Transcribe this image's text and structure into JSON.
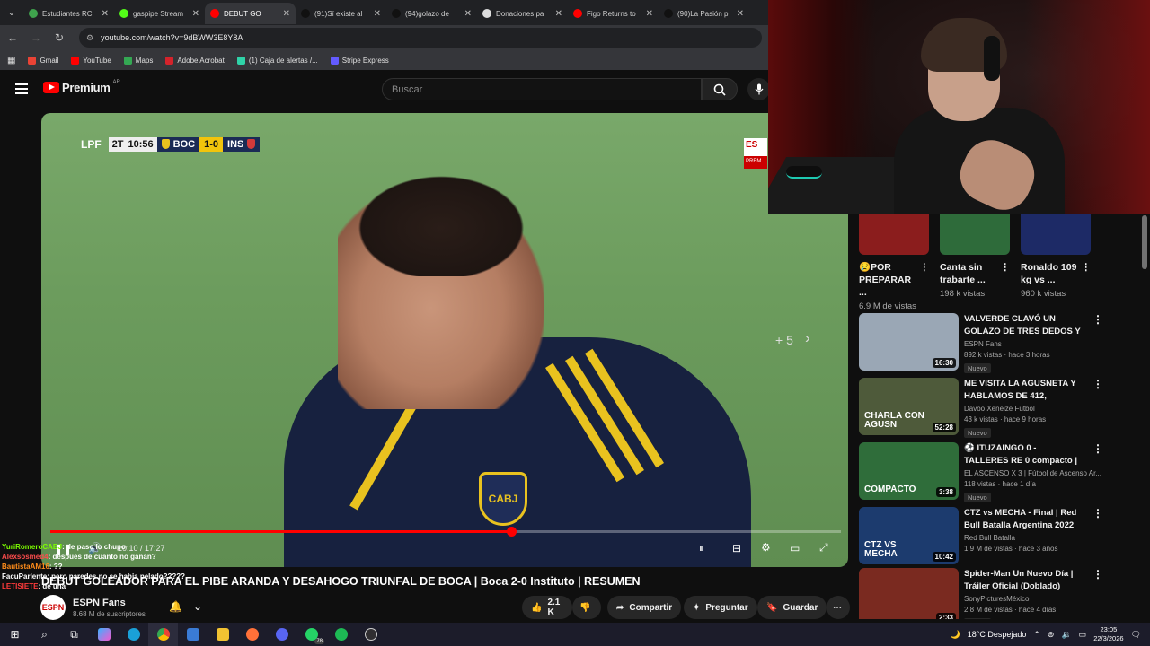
{
  "browser": {
    "tabs": [
      {
        "label": "Estudiantes RC",
        "color": "#3fa34d",
        "active": false
      },
      {
        "label": "gaspipe Stream",
        "color": "#53fc18",
        "active": false
      },
      {
        "label": "DEBUT GO",
        "color": "#ff0000",
        "active": true
      },
      {
        "label": "(91)Sí existe al",
        "color": "#111111",
        "active": false
      },
      {
        "label": "(94)golazo de",
        "color": "#111111",
        "active": false
      },
      {
        "label": "Donaciones pa",
        "color": "#dddddd",
        "active": false
      },
      {
        "label": "Figo Returns to",
        "color": "#ff0000",
        "active": false
      },
      {
        "label": "(90)La Pasión p",
        "color": "#111111",
        "active": false
      }
    ],
    "url": "youtube.com/watch?v=9dBWW3E8Y8A",
    "bookmarks": [
      {
        "label": "Gmail",
        "color": "#ea4335"
      },
      {
        "label": "YouTube",
        "color": "#ff0000"
      },
      {
        "label": "Maps",
        "color": "#34a853"
      },
      {
        "label": "Adobe Acrobat",
        "color": "#d4232b"
      },
      {
        "label": "(1) Caja de alertas /...",
        "color": "#2fd3a8"
      },
      {
        "label": "Stripe Express",
        "color": "#635bff"
      }
    ]
  },
  "youtube": {
    "logo_text": "Premium",
    "country": "AR",
    "search_placeholder": "Buscar"
  },
  "video": {
    "scorebug": {
      "league": "LPF",
      "period": "2T",
      "clock": "10:56",
      "home": "BOC",
      "score": "1-0",
      "away": "INS"
    },
    "espn_top": "ES",
    "espn_bottom": "PREM",
    "more_label": "+ 5",
    "badge_text": "CABJ",
    "time": "10:10 / 17:27",
    "progress_fraction": 0.583
  },
  "chat": [
    {
      "user": "YuriRomeroCABJ",
      "msg": ": de paso lo chupo",
      "color": "#7cfc00"
    },
    {
      "user": "Alexsosmed4",
      "msg": ": despues de cuanto no ganan?",
      "color": "#ff4d4d"
    },
    {
      "user": "BautistaAM16",
      "msg": ": ??",
      "color": "#ff8c1a"
    },
    {
      "user": "FacuParlente",
      "msg": ": pero paredes no se habia pelado?????",
      "color": "#ffffff"
    },
    {
      "user": "LETISIETE",
      "msg": ": de una",
      "color": "#ff3b3b"
    }
  ],
  "title": "DEBUT GOLEADOR PARA EL PIBE ARANDA Y DESAHOGO TRIUNFAL DE BOCA | Boca 2-0 Instituto | RESUMEN",
  "channel": {
    "name": "ESPN Fans",
    "avatar_text": "ESPN",
    "subs": "8.68 M de suscriptores"
  },
  "actions": {
    "likes": "2.1 K",
    "share": "Compartir",
    "ask": "Preguntar",
    "save": "Guardar"
  },
  "shorts": [
    {
      "title": "😢POR PREPARAR ...",
      "views": "6.9 M de vistas",
      "color": "#8b1d1d"
    },
    {
      "title": "Canta sin trabarte ...",
      "views": "198 k vistas",
      "color": "#2e6b3a"
    },
    {
      "title": "Ronaldo 109 kg vs ...",
      "views": "960 k vistas",
      "color": "#1d2a66"
    }
  ],
  "recommendations": [
    {
      "title": "VALVERDE CLAVÓ UN GOLAZO DE TRES DEDOS Y TRIUNFO ...",
      "channel": "ESPN Fans",
      "stats": "892 k vistas · hace 3 horas",
      "badge": "Nuevo",
      "duration": "16:30",
      "thumb": "#9aa7b5"
    },
    {
      "title": "ME VISITA LA AGUSNETA Y HABLAMOS DE 412, MUJERE...",
      "channel": "Davoo Xeneize Futbol",
      "stats": "43 k vistas · hace 9 horas",
      "badge": "Nuevo",
      "duration": "52:28",
      "thumb": "#4e5a3a",
      "thumb_text": "CHARLA CON AGUSN"
    },
    {
      "title": "⚽ ITUZAINGO 0 - TALLERES RE 0 compacto | Fecha 7 - ...",
      "channel": "EL ASCENSO X 3 | Fútbol de Ascenso Ar...",
      "stats": "118 vistas · hace 1 día",
      "badge": "Nuevo",
      "duration": "3:38",
      "thumb": "#2f6d3a",
      "thumb_text": "COMPACTO"
    },
    {
      "title": "CTZ vs MECHA - Final | Red Bull Batalla Argentina 2022",
      "channel": "Red Bull Batalla",
      "stats": "1.9 M de vistas · hace 3 años",
      "badge": "",
      "duration": "10:42",
      "thumb": "#1c3b6e",
      "thumb_text": "CTZ VS MECHA"
    },
    {
      "title": "Spider-Man Un Nuevo Día | Tráiler Oficial (Doblado)",
      "channel": "SonyPicturesMéxico",
      "stats": "2.8 M de vistas · hace 4 días",
      "badge": "Nuevo",
      "duration": "2:33",
      "thumb": "#7a2a20"
    }
  ],
  "taskbar": {
    "weather": "18°C Despejado",
    "time": "23:05",
    "date": "22/3/2026",
    "whatsapp_count": "78"
  }
}
